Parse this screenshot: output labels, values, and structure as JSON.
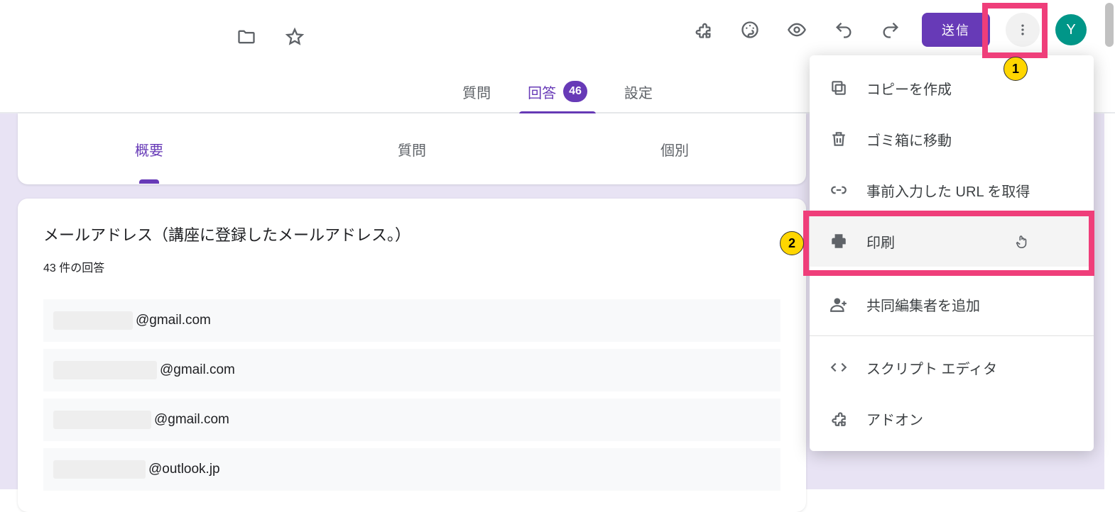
{
  "toolbar": {
    "send_label": "送信",
    "avatar_initial": "Y"
  },
  "tabs": {
    "questions": "質問",
    "responses": "回答",
    "responses_count": "46",
    "settings": "設定"
  },
  "subtabs": {
    "summary": "概要",
    "question": "質問",
    "individual": "個別"
  },
  "card": {
    "title": "メールアドレス（講座に登録したメールアドレス。）",
    "subtitle": "43 件の回答",
    "rows": [
      {
        "mask_w": 112,
        "suffix": "@gmail.com"
      },
      {
        "mask_w": 146,
        "suffix": "@gmail.com"
      },
      {
        "mask_w": 138,
        "suffix": "@gmail.com"
      },
      {
        "mask_w": 130,
        "suffix": "@outlook.jp"
      }
    ]
  },
  "menu": {
    "copy": "コピーを作成",
    "trash": "ゴミ箱に移動",
    "prefill_url": "事前入力した URL を取得",
    "print": "印刷",
    "add_collab": "共同編集者を追加",
    "script": "スクリプト エディタ",
    "addons": "アドオン"
  },
  "annotations": {
    "n1": "1",
    "n2": "2"
  }
}
